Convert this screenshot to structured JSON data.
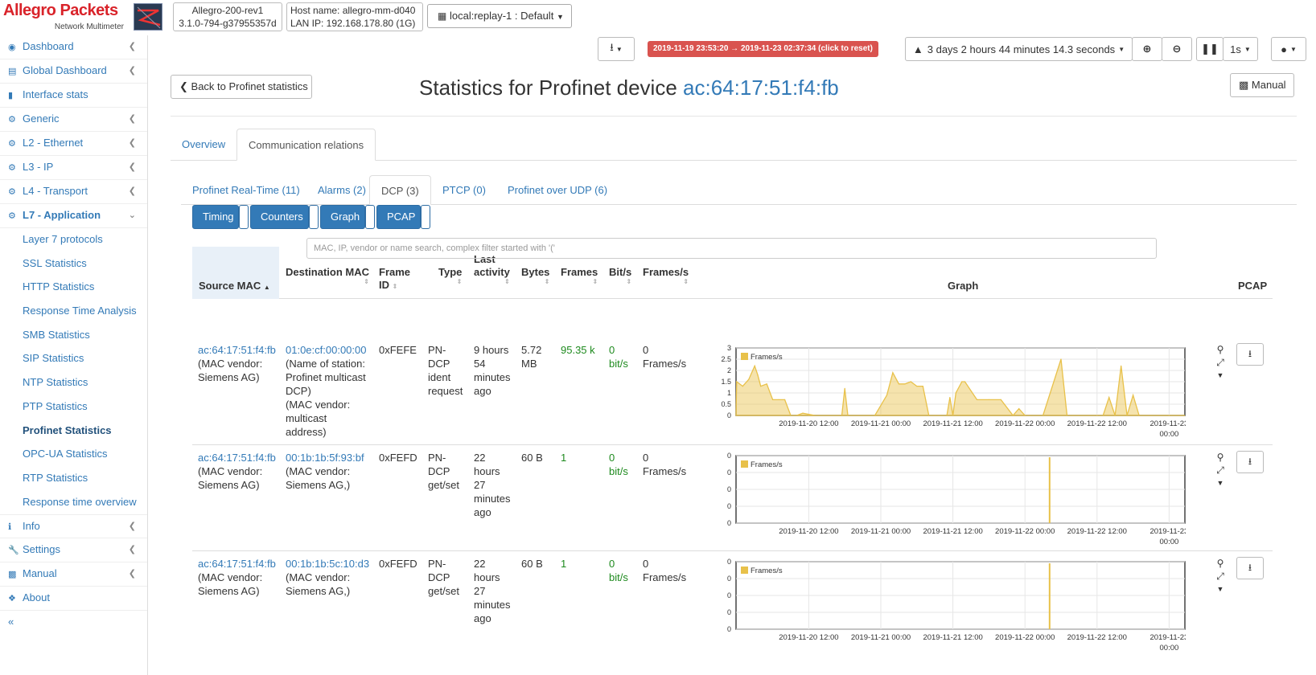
{
  "header": {
    "logo_title": "Allegro Packets",
    "logo_subtitle": "Network Multimeter",
    "device_name": "Allegro-200-rev1",
    "device_version": "3.1.0-794-g37955357d",
    "host_name": "Host name: allegro-mm-d040",
    "lan_ip": "LAN IP: 192.168.178.80 (1G)",
    "replay_label": "local:replay-1 : Default",
    "time_range": "2019-11-19 23:53:20 → 2019-11-23 02:37:34  (click to reset)",
    "duration": "3 days 2 hours 44 minutes 14.3 seconds",
    "interval": "1s"
  },
  "sidebar": {
    "items": [
      {
        "label": "Dashboard"
      },
      {
        "label": "Global Dashboard"
      },
      {
        "label": "Interface stats"
      },
      {
        "label": "Generic"
      },
      {
        "label": "L2 - Ethernet"
      },
      {
        "label": "L3 - IP"
      },
      {
        "label": "L4 - Transport"
      },
      {
        "label": "L7 - Application"
      }
    ],
    "sub_items": [
      {
        "label": "Layer 7 protocols"
      },
      {
        "label": "SSL Statistics"
      },
      {
        "label": "HTTP Statistics"
      },
      {
        "label": "Response Time Analysis"
      },
      {
        "label": "SMB Statistics"
      },
      {
        "label": "SIP Statistics"
      },
      {
        "label": "NTP Statistics"
      },
      {
        "label": "PTP Statistics"
      },
      {
        "label": "Profinet Statistics"
      },
      {
        "label": "OPC-UA Statistics"
      },
      {
        "label": "RTP Statistics"
      },
      {
        "label": "Response time overview"
      }
    ],
    "bottom_items": [
      {
        "label": "Info"
      },
      {
        "label": "Settings"
      },
      {
        "label": "Manual"
      },
      {
        "label": "About"
      }
    ],
    "collapse": "«"
  },
  "main": {
    "back_label": "Back to Profinet statistics",
    "title_prefix": "Statistics for Profinet device",
    "title_mac": "ac:64:17:51:f4:fb",
    "manual_label": "Manual",
    "tabs": [
      {
        "label": "Overview"
      },
      {
        "label": "Communication relations"
      }
    ],
    "subtabs": [
      {
        "label": "Profinet Real-Time (11)"
      },
      {
        "label": "Alarms (2)"
      },
      {
        "label": "DCP (3)"
      },
      {
        "label": "PTCP (0)"
      },
      {
        "label": "Profinet over UDP (6)"
      }
    ],
    "column_buttons": [
      {
        "label": "Timing"
      },
      {
        "label": "Counters"
      },
      {
        "label": "Graph"
      },
      {
        "label": "PCAP"
      }
    ],
    "columns": {
      "source_mac": "Source MAC",
      "dest_mac": "Destination MAC",
      "frame_id_1": "Frame",
      "frame_id_2": "ID",
      "type": "Type",
      "last_activity_1": "Last",
      "last_activity_2": "activity",
      "bytes": "Bytes",
      "frames": "Frames",
      "bits": "Bit/s",
      "frames_s": "Frames/s",
      "graph": "Graph",
      "pcap": "PCAP"
    },
    "filter_placeholder": "MAC, IP, vendor or name search, complex filter started with '('",
    "rows": [
      {
        "src_mac": "ac:64:17:51:f4:fb",
        "src_vendor_1": "(MAC vendor:",
        "src_vendor_2": "Siemens AG)",
        "dst_mac": "01:0e:cf:00:00:00",
        "dst_l1": "(Name of station:",
        "dst_l2": "Profinet multicast",
        "dst_l3": "DCP)",
        "dst_l4": "(MAC vendor:",
        "dst_l5": "multicast",
        "dst_l6": "address)",
        "frame_id": "0xFEFE",
        "type_1": "PN-",
        "type_2": "DCP",
        "type_3": "ident",
        "type_4": "request",
        "act_1": "9 hours",
        "act_2": "54",
        "act_3": "minutes",
        "act_4": "ago",
        "bytes_1": "5.72",
        "bytes_2": "MB",
        "frames": "95.35 k",
        "bits_1": "0",
        "bits_2": "bit/s",
        "fps_1": "0",
        "fps_2": "Frames/s"
      },
      {
        "src_mac": "ac:64:17:51:f4:fb",
        "src_vendor_1": "(MAC vendor:",
        "src_vendor_2": "Siemens AG)",
        "dst_mac": "00:1b:1b:5f:93:bf",
        "dst_l1": "(MAC vendor:",
        "dst_l2": "Siemens AG,)",
        "frame_id": "0xFEFD",
        "type_1": "PN-",
        "type_2": "DCP",
        "type_3": "get/set",
        "act_1": "22",
        "act_2": "hours",
        "act_3": "27",
        "act_4": "minutes",
        "act_5": "ago",
        "bytes_1": "60 B",
        "frames": "1",
        "bits_1": "0",
        "bits_2": "bit/s",
        "fps_1": "0",
        "fps_2": "Frames/s"
      },
      {
        "src_mac": "ac:64:17:51:f4:fb",
        "src_vendor_1": "(MAC vendor:",
        "src_vendor_2": "Siemens AG)",
        "dst_mac": "00:1b:1b:5c:10:d3",
        "dst_l1": "(MAC vendor:",
        "dst_l2": "Siemens AG,)",
        "frame_id": "0xFEFD",
        "type_1": "PN-",
        "type_2": "DCP",
        "type_3": "get/set",
        "act_1": "22",
        "act_2": "hours",
        "act_3": "27",
        "act_4": "minutes",
        "act_5": "ago",
        "bytes_1": "60 B",
        "frames": "1",
        "bits_1": "0",
        "bits_2": "bit/s",
        "fps_1": "0",
        "fps_2": "Frames/s"
      }
    ]
  },
  "chart_data": [
    {
      "type": "area",
      "legend": "Frames/s",
      "y_ticks": [
        "0",
        "0.5",
        "1",
        "1.5",
        "2",
        "2.5",
        "3"
      ],
      "x_ticks": [
        "2019-11-20 12:00",
        "2019-11-21 00:00",
        "2019-11-21 12:00",
        "2019-11-22 00:00",
        "2019-11-22 12:00",
        "2019-11-23 00:00"
      ],
      "ylim": [
        0,
        3
      ],
      "color": "#e8c14a",
      "series": [
        {
          "x": [
            "2019-11-20 00:00",
            "2019-11-20 01:00",
            "2019-11-20 02:00",
            "2019-11-20 03:00",
            "2019-11-20 03:30",
            "2019-11-20 04:00",
            "2019-11-20 05:00",
            "2019-11-20 06:00",
            "2019-11-20 07:00",
            "2019-11-20 08:00",
            "2019-11-20 09:00",
            "2019-11-20 10:00",
            "2019-11-20 11:00",
            "2019-11-20 13:00",
            "2019-11-20 17:30",
            "2019-11-20 18:00",
            "2019-11-20 18:30",
            "2019-11-20 23:00",
            "2019-11-21 01:00",
            "2019-11-21 02:00",
            "2019-11-21 03:00",
            "2019-11-21 04:00",
            "2019-11-21 05:00",
            "2019-11-21 06:00",
            "2019-11-21 07:00",
            "2019-11-21 08:00",
            "2019-11-21 09:00",
            "2019-11-21 10:00",
            "2019-11-21 11:00",
            "2019-11-21 11:30",
            "2019-11-21 12:00",
            "2019-11-21 12:30",
            "2019-11-21 13:30",
            "2019-11-21 14:00",
            "2019-11-21 16:00",
            "2019-11-21 18:00",
            "2019-11-21 20:00",
            "2019-11-21 22:00",
            "2019-11-21 23:00",
            "2019-11-22 00:00",
            "2019-11-22 01:00",
            "2019-11-22 03:00",
            "2019-11-22 06:00",
            "2019-11-22 07:00",
            "2019-11-22 08:00",
            "2019-11-22 13:00",
            "2019-11-22 14:00",
            "2019-11-22 15:00",
            "2019-11-22 16:00",
            "2019-11-22 17:00",
            "2019-11-22 18:00",
            "2019-11-22 19:00",
            "2019-11-22 21:00",
            "2019-11-23 02:00"
          ],
          "y": [
            1.5,
            1.3,
            1.6,
            2.2,
            1.8,
            1.3,
            1.4,
            0.7,
            0.7,
            0.7,
            0,
            0,
            0.1,
            0,
            0,
            1.2,
            0,
            0,
            0.9,
            1.9,
            1.4,
            1.4,
            1.5,
            1.3,
            1.3,
            0,
            0,
            0,
            0,
            0.8,
            0,
            1.0,
            1.5,
            1.5,
            0.7,
            0.7,
            0.7,
            0,
            0.3,
            0,
            0,
            0,
            2.5,
            0,
            0,
            0,
            0.8,
            0,
            2.2,
            0,
            0.9,
            0,
            0,
            0
          ]
        }
      ]
    },
    {
      "type": "area",
      "legend": "Frames/s",
      "y_ticks": [
        "0",
        "0",
        "0",
        "0",
        "0"
      ],
      "x_ticks": [
        "2019-11-20 12:00",
        "2019-11-21 00:00",
        "2019-11-21 12:00",
        "2019-11-22 00:00",
        "2019-11-22 12:00",
        "2019-11-23 00:00"
      ],
      "color": "#e8c14a",
      "series": [
        {
          "x": [
            "2019-11-22 04:06"
          ],
          "y": [
            1
          ],
          "note_peak": true
        }
      ]
    },
    {
      "type": "area",
      "legend": "Frames/s",
      "y_ticks": [
        "0",
        "0",
        "0",
        "0",
        "0"
      ],
      "x_ticks": [
        "2019-11-20 12:00",
        "2019-11-21 00:00",
        "2019-11-21 12:00",
        "2019-11-22 00:00",
        "2019-11-22 12:00",
        "2019-11-23 00:00"
      ],
      "color": "#e8c14a",
      "series": [
        {
          "x": [
            "2019-11-22 04:06"
          ],
          "y": [
            1
          ],
          "note_peak": true
        }
      ]
    }
  ]
}
